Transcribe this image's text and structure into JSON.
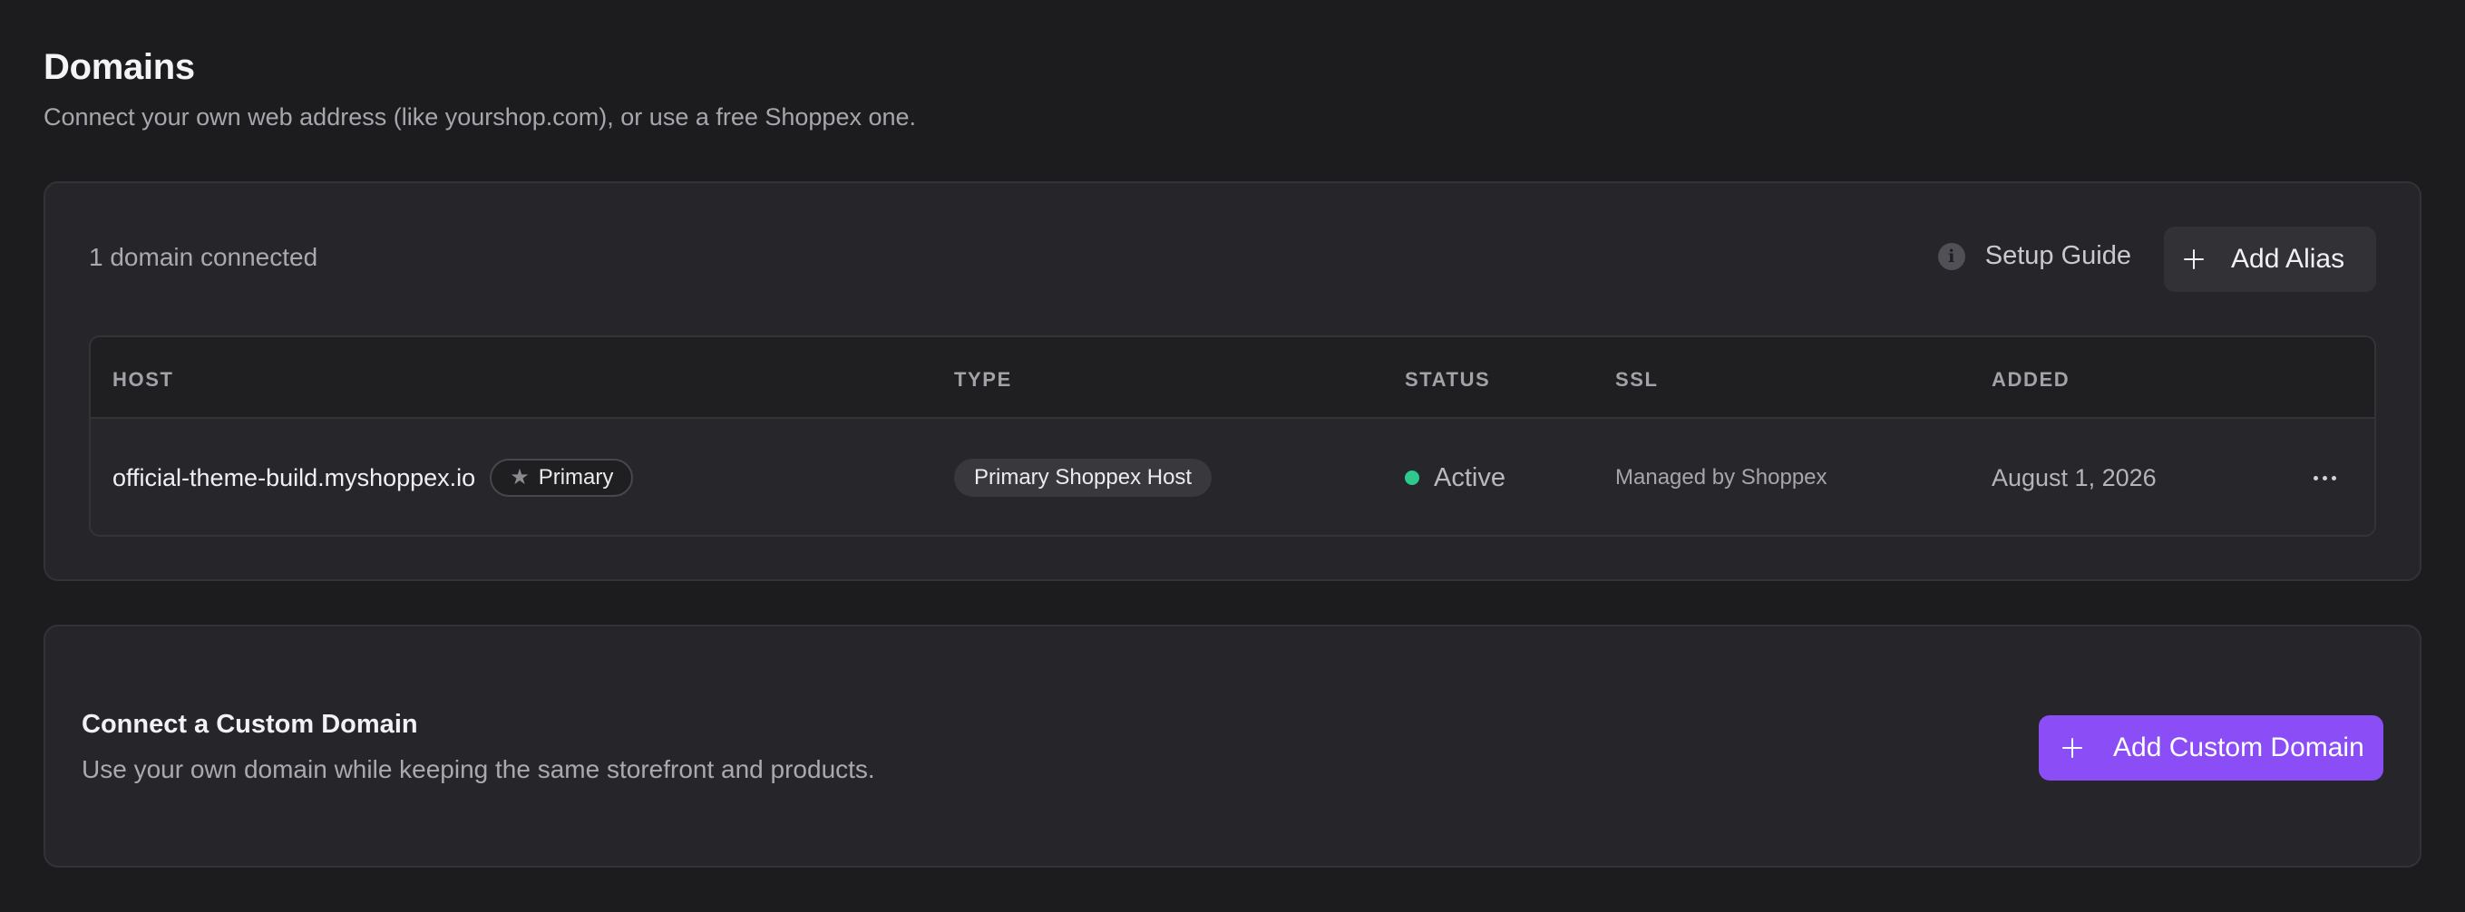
{
  "page": {
    "title": "Domains",
    "subtitle": "Connect your own web address (like yourshop.com), or use a free Shoppex one."
  },
  "domains_card": {
    "count_text": "1 domain connected",
    "setup_guide_label": "Setup Guide",
    "add_alias_label": "Add Alias",
    "columns": [
      "HOST",
      "TYPE",
      "STATUS",
      "SSL",
      "ADDED"
    ],
    "rows": [
      {
        "host": "official-theme-build.myshoppex.io",
        "badge": "Primary",
        "type": "Primary Shoppex Host",
        "status": "Active",
        "ssl": "Managed by Shoppex",
        "added": "August 1, 2026"
      }
    ]
  },
  "custom_card": {
    "title": "Connect a Custom Domain",
    "description": "Use your own domain while keeping the same storefront and products.",
    "button_label": "Add Custom Domain"
  },
  "colors": {
    "background": "#1c1c1f",
    "card": "#26262a",
    "accent": "#8b4ef6",
    "status_active": "#2ec98c"
  },
  "icons": {
    "setup_guide": "info-icon",
    "add": "plus-icon",
    "badge": "star-icon",
    "row_menu": "more-horizontal-icon",
    "status": "status-dot"
  }
}
